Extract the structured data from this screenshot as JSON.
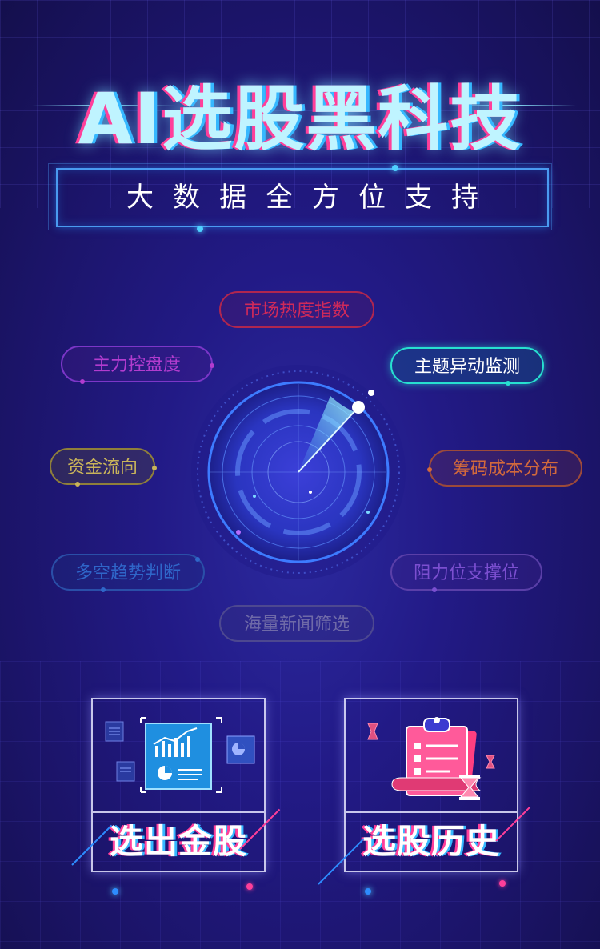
{
  "header": {
    "title": "AI选股黑科技",
    "subtitle": "大数据全方位支持"
  },
  "tags": [
    {
      "id": "market-heat",
      "label": "市场热度指数",
      "color": "#d02a5a",
      "border": "#b0264f",
      "bg": "rgba(120,20,70,0.18)"
    },
    {
      "id": "main-force",
      "label": "主力控盘度",
      "color": "#b23ccf",
      "border": "#7c36c8",
      "bg": "rgba(90,30,140,0.20)"
    },
    {
      "id": "theme-monitor",
      "label": "主题异动监测",
      "color": "#ffffff",
      "border": "#27e0d0",
      "bg": "rgba(20,90,140,0.40)"
    },
    {
      "id": "capital-flow",
      "label": "资金流向",
      "color": "#c9b45a",
      "border": "#8f7f3a",
      "bg": "rgba(90,80,50,0.30)"
    },
    {
      "id": "chip-cost",
      "label": "筹码成本分布",
      "color": "#d2693c",
      "border": "#9c4a3a",
      "bg": "rgba(120,50,60,0.25)"
    },
    {
      "id": "trend-judgment",
      "label": "多空趋势判断",
      "color": "#2f66c9",
      "border": "#2a4fa8",
      "bg": "rgba(30,50,130,0.30)"
    },
    {
      "id": "support-resistance",
      "label": "阻力位支撑位",
      "color": "#7b4fd0",
      "border": "#5a3fa8",
      "bg": "rgba(70,40,140,0.25)"
    },
    {
      "id": "news-screening",
      "label": "海量新闻筛选",
      "color": "#6f6aa8",
      "border": "#4d4890",
      "bg": "rgba(60,55,120,0.25)"
    }
  ],
  "cards": [
    {
      "id": "select-gold",
      "label": "选出金股",
      "icon": "chart-report-icon"
    },
    {
      "id": "history",
      "label": "选股历史",
      "icon": "clipboard-hourglass-icon"
    }
  ],
  "colors": {
    "accent_cyan": "#4fd0ff",
    "accent_pink": "#ff3f9a",
    "radar_blue": "#3a6cff"
  }
}
